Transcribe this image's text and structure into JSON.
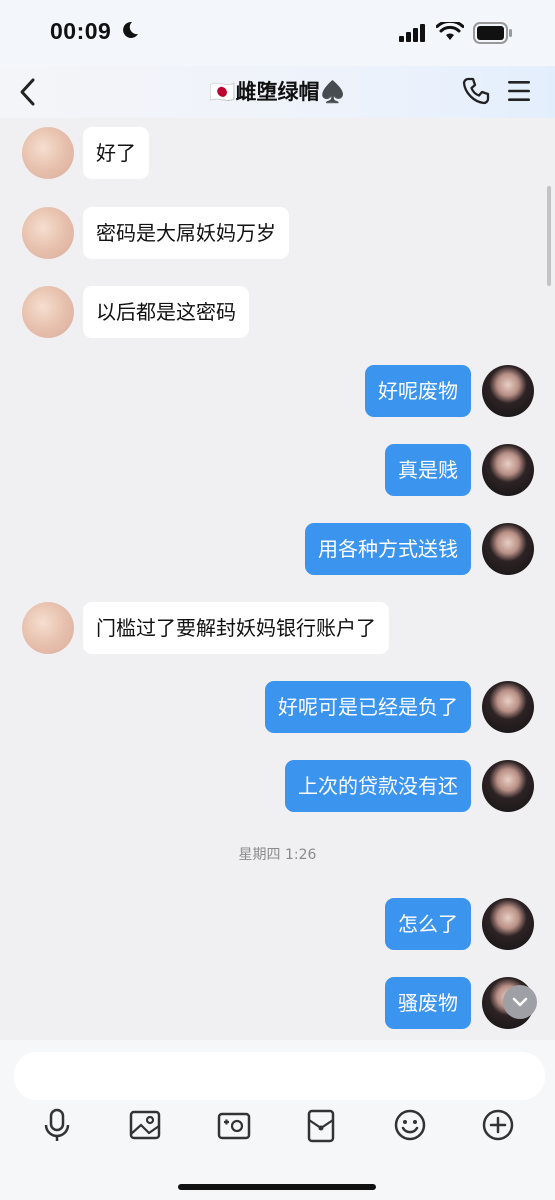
{
  "status_bar": {
    "time": "00:09",
    "moon_icon": "moon-icon",
    "signal_icon": "cellular-signal-icon",
    "wifi_icon": "wifi-icon",
    "battery_icon": "battery-icon"
  },
  "header": {
    "title": "🇯🇵雌堕绿帽♠️",
    "back_icon": "chevron-left-icon",
    "call_icon": "phone-icon",
    "menu_icon": "hamburger-menu-icon"
  },
  "messages": [
    {
      "side": "in",
      "text": "好了"
    },
    {
      "side": "in",
      "text": "密码是大屌妖妈万岁"
    },
    {
      "side": "in",
      "text": "以后都是这密码"
    },
    {
      "side": "out",
      "text": "好呢废物"
    },
    {
      "side": "out",
      "text": "真是贱"
    },
    {
      "side": "out",
      "text": "用各种方式送钱"
    },
    {
      "side": "in",
      "text": "门槛过了要解封妖妈银行账户了"
    },
    {
      "side": "out",
      "text": "好呢可是已经是负了"
    },
    {
      "side": "out",
      "text": "上次的贷款没有还"
    },
    {
      "side": "out",
      "text": "怎么了"
    },
    {
      "side": "out",
      "text": "骚废物"
    }
  ],
  "timestamp": "星期四 1:26",
  "composer": {
    "placeholder": ""
  },
  "toolbar": [
    "microphone-icon",
    "image-icon",
    "camera-icon",
    "red-packet-icon",
    "emoji-icon",
    "plus-icon"
  ],
  "colors": {
    "outgoing_bubble": "#3b94ee",
    "incoming_bubble": "#ffffff",
    "background": "#f0f0f2"
  }
}
